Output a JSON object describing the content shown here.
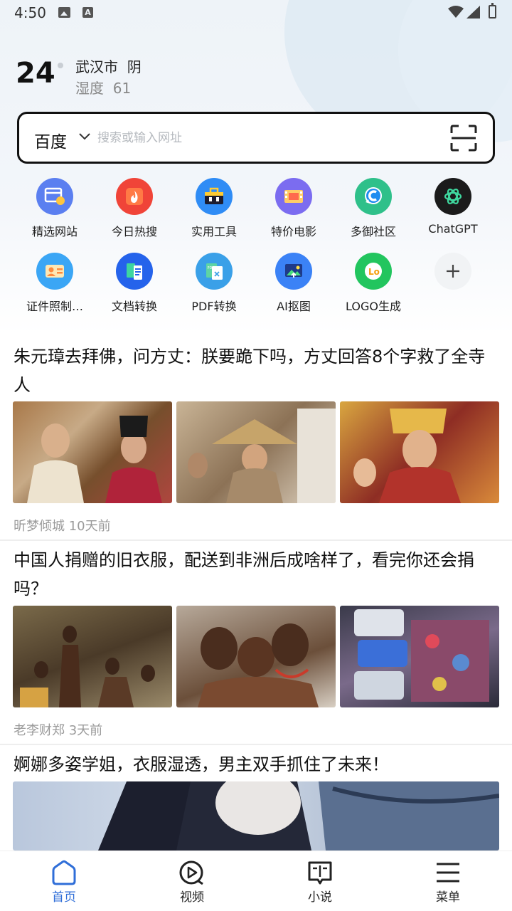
{
  "status_bar": {
    "time": "4:50",
    "icons": [
      "image-icon",
      "a-icon",
      "wifi-icon",
      "signal-icon",
      "battery-icon"
    ]
  },
  "weather": {
    "temperature": "24",
    "city_line": "武汉市  阴",
    "humidity_line": "湿度  61"
  },
  "search": {
    "engine": "百度",
    "placeholder": "搜索或输入网址",
    "value": ""
  },
  "quick_links": [
    {
      "label": "精选网站",
      "icon": "featured-sites-icon",
      "color": "#5b7ff0"
    },
    {
      "label": "今日热搜",
      "icon": "hot-search-icon",
      "color": "#f04438"
    },
    {
      "label": "实用工具",
      "icon": "toolbox-icon",
      "color": "#2f8cf5"
    },
    {
      "label": "特价电影",
      "icon": "movie-icon",
      "color": "#7b6cf0"
    },
    {
      "label": "多御社区",
      "icon": "community-icon",
      "color": "#2fc08a"
    },
    {
      "label": "ChatGPT",
      "icon": "chatgpt-icon",
      "color": "#1b1b1b"
    },
    {
      "label": "证件照制…",
      "icon": "id-photo-icon",
      "color": "#3ba6f5"
    },
    {
      "label": "文档转换",
      "icon": "doc-convert-icon",
      "color": "#2563eb"
    },
    {
      "label": "PDF转换",
      "icon": "pdf-convert-icon",
      "color": "#3aa0e8"
    },
    {
      "label": "AI抠图",
      "icon": "ai-cutout-icon",
      "color": "#3b82f6"
    },
    {
      "label": "LOGO生成",
      "icon": "logo-gen-icon",
      "color": "#22c55e"
    },
    {
      "label": "",
      "icon": "add-icon",
      "color": "#f1f3f5"
    }
  ],
  "feed": [
    {
      "title": "朱元璋去拜佛，问方丈：朕要跪下吗，方丈回答8个字救了全寺人",
      "meta": "昕梦倾城 10天前"
    },
    {
      "title": "中国人捐赠的旧衣服，配送到非洲后成啥样了，看完你还会捐吗？",
      "meta": "老李财郑 3天前"
    },
    {
      "title": "婀娜多姿学姐，衣服湿透，男主双手抓住了未来！",
      "meta": ""
    }
  ],
  "bottom_nav": [
    {
      "label": "首页",
      "icon": "home-icon",
      "active": true
    },
    {
      "label": "视频",
      "icon": "video-icon",
      "active": false
    },
    {
      "label": "小说",
      "icon": "novel-icon",
      "active": false
    },
    {
      "label": "菜单",
      "icon": "menu-icon",
      "active": false
    }
  ],
  "colors": {
    "accent": "#2f6ed8",
    "meta_text": "#9a9a9a"
  }
}
